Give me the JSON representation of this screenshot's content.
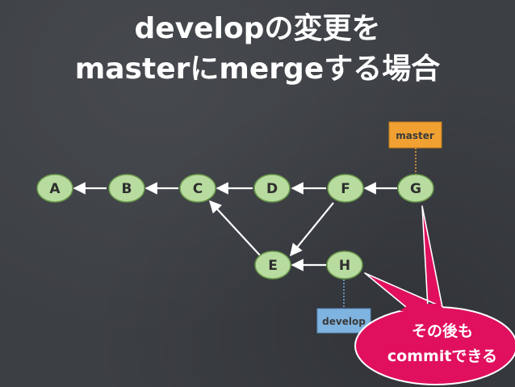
{
  "title": {
    "line1": "developの変更を",
    "line2": "masterにmergeする場合"
  },
  "nodes": {
    "A": "A",
    "B": "B",
    "C": "C",
    "D": "D",
    "E": "E",
    "F": "F",
    "G": "G",
    "H": "H"
  },
  "tags": {
    "master": "master",
    "develop": "develop"
  },
  "callout": {
    "line1": "その後も",
    "line2": "commitできる"
  },
  "colors": {
    "node_fill": "#b8dba0",
    "node_stroke": "#6a9a4a",
    "master_tag": "#f0a132",
    "develop_tag": "#7fb3e0",
    "callout": "#e0105e"
  }
}
